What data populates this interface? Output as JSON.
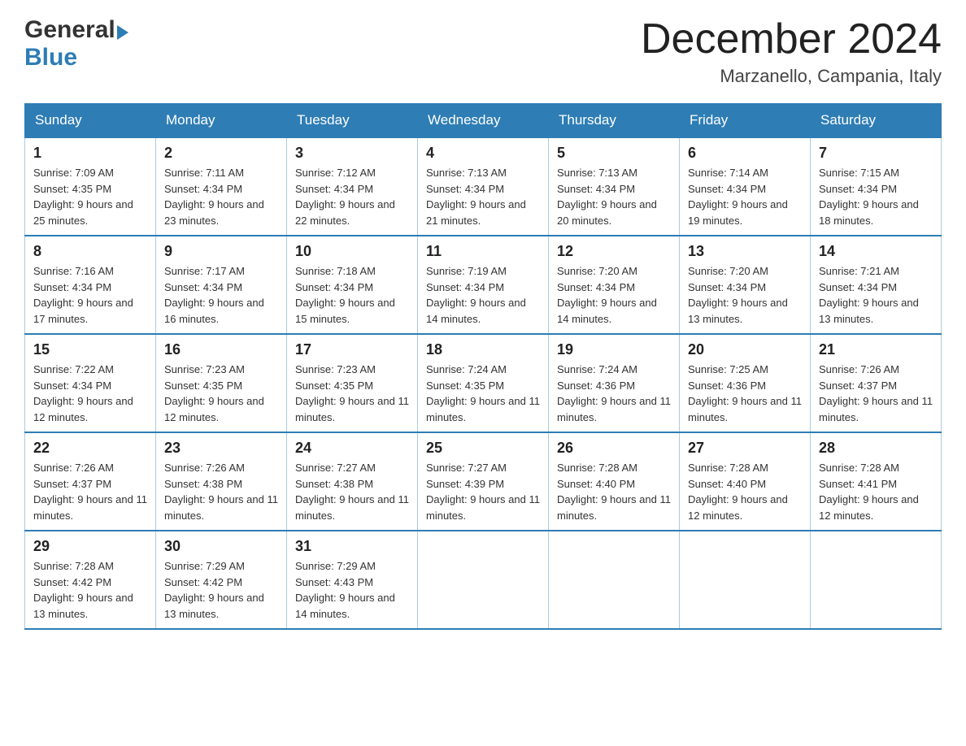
{
  "header": {
    "logo_general": "General",
    "logo_blue": "Blue",
    "title": "December 2024",
    "subtitle": "Marzanello, Campania, Italy"
  },
  "calendar": {
    "days_of_week": [
      "Sunday",
      "Monday",
      "Tuesday",
      "Wednesday",
      "Thursday",
      "Friday",
      "Saturday"
    ],
    "weeks": [
      [
        {
          "day": "1",
          "sunrise": "7:09 AM",
          "sunset": "4:35 PM",
          "daylight": "9 hours and 25 minutes."
        },
        {
          "day": "2",
          "sunrise": "7:11 AM",
          "sunset": "4:34 PM",
          "daylight": "9 hours and 23 minutes."
        },
        {
          "day": "3",
          "sunrise": "7:12 AM",
          "sunset": "4:34 PM",
          "daylight": "9 hours and 22 minutes."
        },
        {
          "day": "4",
          "sunrise": "7:13 AM",
          "sunset": "4:34 PM",
          "daylight": "9 hours and 21 minutes."
        },
        {
          "day": "5",
          "sunrise": "7:13 AM",
          "sunset": "4:34 PM",
          "daylight": "9 hours and 20 minutes."
        },
        {
          "day": "6",
          "sunrise": "7:14 AM",
          "sunset": "4:34 PM",
          "daylight": "9 hours and 19 minutes."
        },
        {
          "day": "7",
          "sunrise": "7:15 AM",
          "sunset": "4:34 PM",
          "daylight": "9 hours and 18 minutes."
        }
      ],
      [
        {
          "day": "8",
          "sunrise": "7:16 AM",
          "sunset": "4:34 PM",
          "daylight": "9 hours and 17 minutes."
        },
        {
          "day": "9",
          "sunrise": "7:17 AM",
          "sunset": "4:34 PM",
          "daylight": "9 hours and 16 minutes."
        },
        {
          "day": "10",
          "sunrise": "7:18 AM",
          "sunset": "4:34 PM",
          "daylight": "9 hours and 15 minutes."
        },
        {
          "day": "11",
          "sunrise": "7:19 AM",
          "sunset": "4:34 PM",
          "daylight": "9 hours and 14 minutes."
        },
        {
          "day": "12",
          "sunrise": "7:20 AM",
          "sunset": "4:34 PM",
          "daylight": "9 hours and 14 minutes."
        },
        {
          "day": "13",
          "sunrise": "7:20 AM",
          "sunset": "4:34 PM",
          "daylight": "9 hours and 13 minutes."
        },
        {
          "day": "14",
          "sunrise": "7:21 AM",
          "sunset": "4:34 PM",
          "daylight": "9 hours and 13 minutes."
        }
      ],
      [
        {
          "day": "15",
          "sunrise": "7:22 AM",
          "sunset": "4:34 PM",
          "daylight": "9 hours and 12 minutes."
        },
        {
          "day": "16",
          "sunrise": "7:23 AM",
          "sunset": "4:35 PM",
          "daylight": "9 hours and 12 minutes."
        },
        {
          "day": "17",
          "sunrise": "7:23 AM",
          "sunset": "4:35 PM",
          "daylight": "9 hours and 11 minutes."
        },
        {
          "day": "18",
          "sunrise": "7:24 AM",
          "sunset": "4:35 PM",
          "daylight": "9 hours and 11 minutes."
        },
        {
          "day": "19",
          "sunrise": "7:24 AM",
          "sunset": "4:36 PM",
          "daylight": "9 hours and 11 minutes."
        },
        {
          "day": "20",
          "sunrise": "7:25 AM",
          "sunset": "4:36 PM",
          "daylight": "9 hours and 11 minutes."
        },
        {
          "day": "21",
          "sunrise": "7:26 AM",
          "sunset": "4:37 PM",
          "daylight": "9 hours and 11 minutes."
        }
      ],
      [
        {
          "day": "22",
          "sunrise": "7:26 AM",
          "sunset": "4:37 PM",
          "daylight": "9 hours and 11 minutes."
        },
        {
          "day": "23",
          "sunrise": "7:26 AM",
          "sunset": "4:38 PM",
          "daylight": "9 hours and 11 minutes."
        },
        {
          "day": "24",
          "sunrise": "7:27 AM",
          "sunset": "4:38 PM",
          "daylight": "9 hours and 11 minutes."
        },
        {
          "day": "25",
          "sunrise": "7:27 AM",
          "sunset": "4:39 PM",
          "daylight": "9 hours and 11 minutes."
        },
        {
          "day": "26",
          "sunrise": "7:28 AM",
          "sunset": "4:40 PM",
          "daylight": "9 hours and 11 minutes."
        },
        {
          "day": "27",
          "sunrise": "7:28 AM",
          "sunset": "4:40 PM",
          "daylight": "9 hours and 12 minutes."
        },
        {
          "day": "28",
          "sunrise": "7:28 AM",
          "sunset": "4:41 PM",
          "daylight": "9 hours and 12 minutes."
        }
      ],
      [
        {
          "day": "29",
          "sunrise": "7:28 AM",
          "sunset": "4:42 PM",
          "daylight": "9 hours and 13 minutes."
        },
        {
          "day": "30",
          "sunrise": "7:29 AM",
          "sunset": "4:42 PM",
          "daylight": "9 hours and 13 minutes."
        },
        {
          "day": "31",
          "sunrise": "7:29 AM",
          "sunset": "4:43 PM",
          "daylight": "9 hours and 14 minutes."
        },
        null,
        null,
        null,
        null
      ]
    ]
  }
}
